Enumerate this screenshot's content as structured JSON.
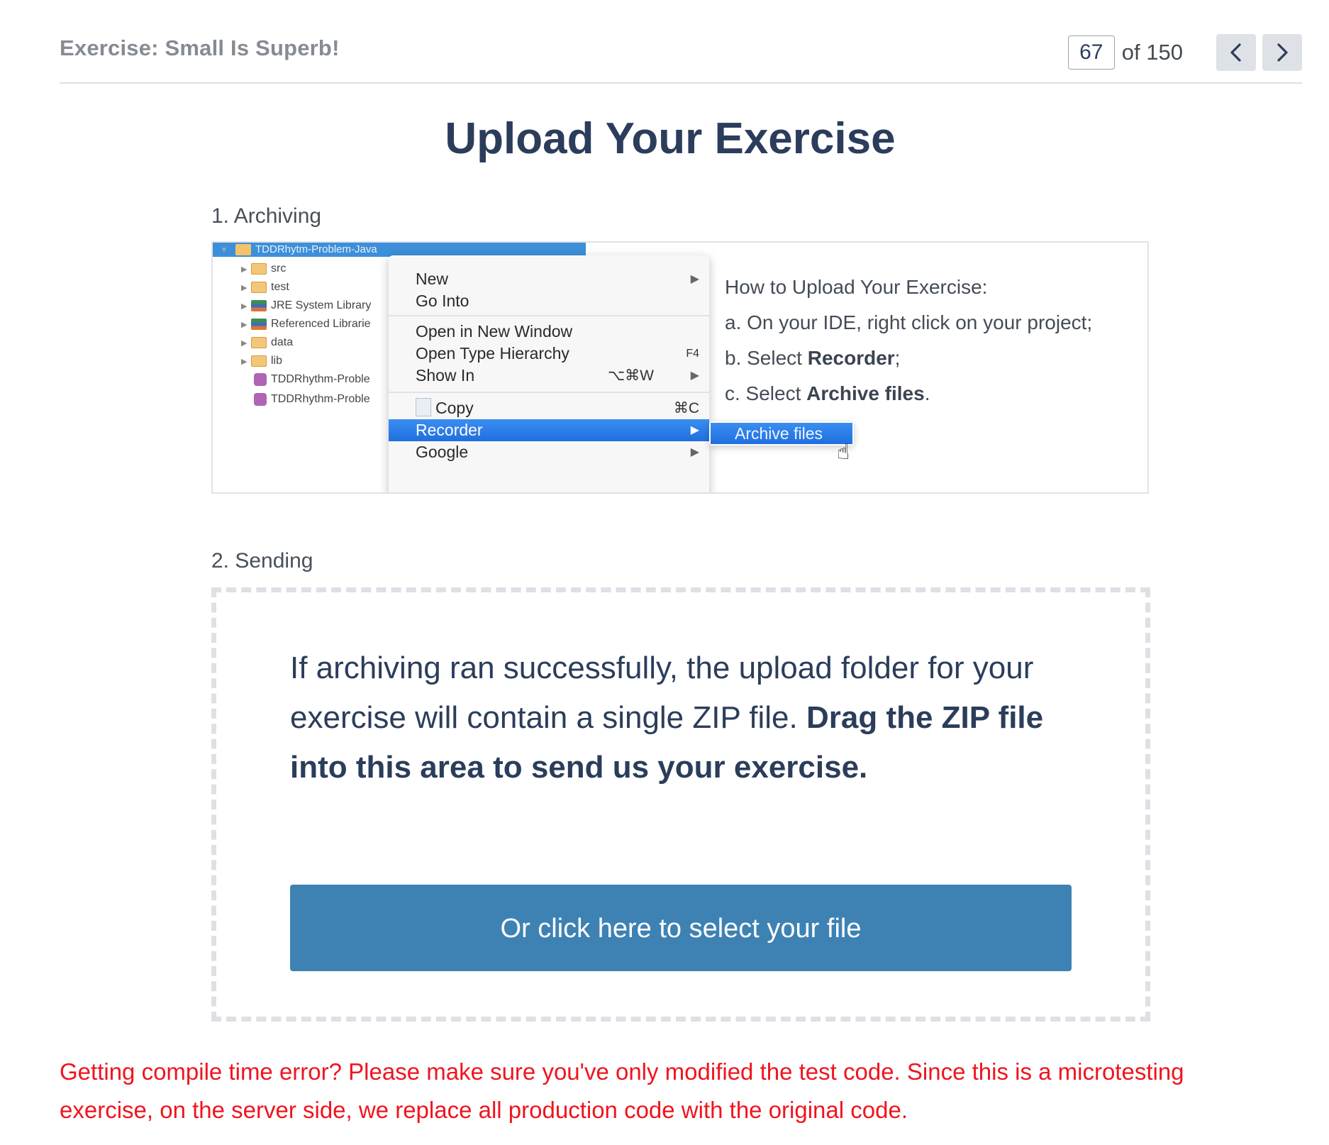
{
  "header": {
    "exercise_title": "Exercise: Small Is Superb!",
    "current_page": "67",
    "page_of": "of 150",
    "prev_icon": "chevron-left-icon",
    "next_icon": "chevron-right-icon"
  },
  "title": "Upload Your Exercise",
  "step1": {
    "label": "1. Archiving",
    "ide_tree": {
      "project": "TDDRhytm-Problem-Java",
      "items": [
        {
          "label": "src",
          "icon": "package-folder-icon"
        },
        {
          "label": "test",
          "icon": "package-folder-icon"
        },
        {
          "label": "JRE System Library",
          "icon": "library-icon"
        },
        {
          "label": "Referenced Librarie",
          "icon": "library-icon"
        },
        {
          "label": "data",
          "icon": "folder-icon"
        },
        {
          "label": "lib",
          "icon": "folder-icon"
        },
        {
          "label": "TDDRhythm-Proble",
          "icon": "launch-file-icon"
        },
        {
          "label": "TDDRhythm-Proble",
          "icon": "launch-file-icon"
        }
      ]
    },
    "context_menu": {
      "items": [
        {
          "label": "New",
          "shortcut": "",
          "submenu": true
        },
        {
          "label": "Go Into",
          "shortcut": "",
          "submenu": false
        },
        {
          "label": "Open in New Window",
          "shortcut": "",
          "submenu": false
        },
        {
          "label": "Open Type Hierarchy",
          "shortcut": "F4",
          "submenu": false
        },
        {
          "label": "Show In",
          "shortcut": "⌥⌘W",
          "submenu": true
        },
        {
          "label": "Copy",
          "shortcut": "⌘C",
          "submenu": false
        },
        {
          "label": "Recorder",
          "shortcut": "",
          "submenu": true,
          "highlighted": true
        },
        {
          "label": "Google",
          "shortcut": "",
          "submenu": true
        }
      ],
      "submenu_item": "Archive files"
    },
    "instructions": {
      "heading": "How to Upload Your Exercise:",
      "a": "a. On your IDE, right click on your project;",
      "b_prefix": "b. Select ",
      "b_bold": "Recorder",
      "b_suffix": ";",
      "c_prefix": "c. Select ",
      "c_bold": "Archive files",
      "c_suffix": "."
    }
  },
  "step2": {
    "label": "2. Sending",
    "drop_text": "If archiving ran successfully, the upload folder for your exercise will contain a single ZIP file.",
    "drop_text_bold": "Drag the ZIP file into this area to send us your exercise.",
    "select_button": "Or click here to select your file"
  },
  "warning": "Getting compile time error? Please make sure you've only modified the test code. Since this is a microtesting exercise, on the server side, we replace all production code with the original code.",
  "colors": {
    "primary_button": "#3e82b4",
    "title_text": "#2b3d5b",
    "warning_text": "#f0141e",
    "menu_highlight": "#2a7be8"
  }
}
